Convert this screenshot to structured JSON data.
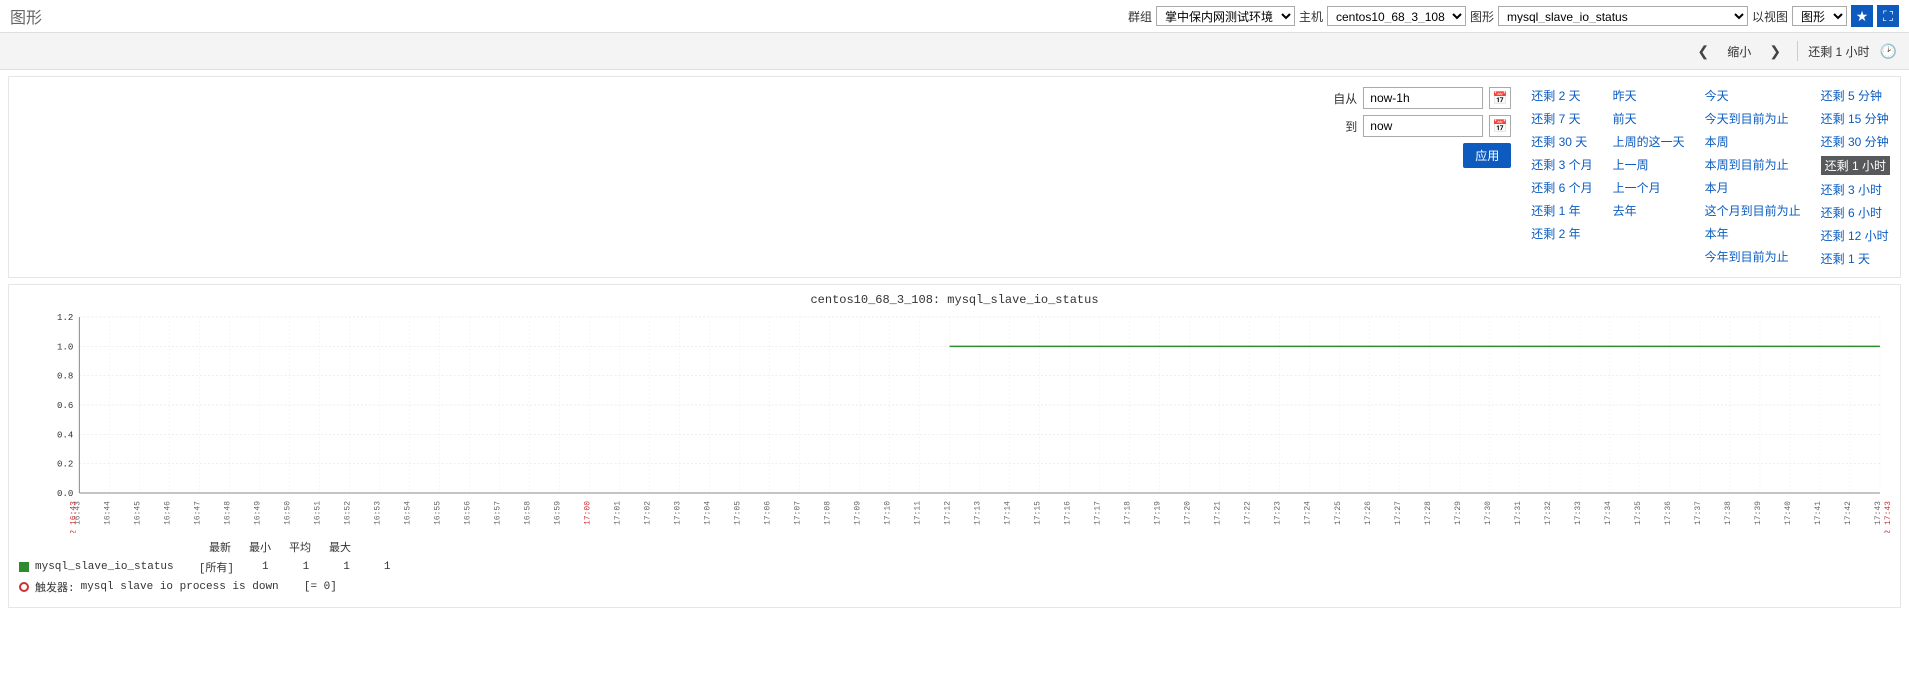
{
  "header": {
    "page_title": "图形",
    "group_label": "群组",
    "group_value": "掌中保内网测试环境",
    "host_label": "主机",
    "host_value": "centos10_68_3_108",
    "graph_label": "图形",
    "graph_value": "mysql_slave_io_status",
    "view_label": "以视图",
    "view_value": "图形"
  },
  "subbar": {
    "zoom_out": "缩小",
    "range_label": "还剩 1 小时"
  },
  "time": {
    "from_label": "自从",
    "from_value": "now-1h",
    "to_label": "到",
    "to_value": "now",
    "apply": "应用"
  },
  "presets": {
    "col1": [
      "还剩 2 天",
      "还剩 7 天",
      "还剩 30 天",
      "还剩 3 个月",
      "还剩 6 个月",
      "还剩 1 年",
      "还剩 2 年"
    ],
    "col2": [
      "昨天",
      "前天",
      "上周的这一天",
      "上一周",
      "上一个月",
      "去年"
    ],
    "col3": [
      "今天",
      "今天到目前为止",
      "本周",
      "本周到目前为止",
      "本月",
      "这个月到目前为止",
      "本年",
      "今年到目前为止"
    ],
    "col4": [
      "还剩 5 分钟",
      "还剩 15 分钟",
      "还剩 30 分钟",
      "还剩 1 小时",
      "还剩 3 小时",
      "还剩 6 小时",
      "还剩 12 小时",
      "还剩 1 天"
    ],
    "selected": "还剩 1 小时"
  },
  "chart_data": {
    "type": "line",
    "title": "centos10_68_3_108: mysql_slave_io_status",
    "ylabel": "",
    "ylim": [
      0,
      1.2
    ],
    "yticks": [
      0,
      0.2,
      0.4,
      0.6,
      0.8,
      1.0,
      1.2
    ],
    "x_start_label": "12-02 16:43",
    "x_end_label": "12-02 17:43",
    "x_ticks": [
      "16:43",
      "16:44",
      "16:45",
      "16:46",
      "16:47",
      "16:48",
      "16:49",
      "16:50",
      "16:51",
      "16:52",
      "16:53",
      "16:54",
      "16:55",
      "16:56",
      "16:57",
      "16:58",
      "16:59",
      "17:00",
      "17:01",
      "17:02",
      "17:03",
      "17:04",
      "17:05",
      "17:06",
      "17:07",
      "17:08",
      "17:09",
      "17:10",
      "17:11",
      "17:12",
      "17:13",
      "17:14",
      "17:15",
      "17:16",
      "17:17",
      "17:18",
      "17:19",
      "17:20",
      "17:21",
      "17:22",
      "17:23",
      "17:24",
      "17:25",
      "17:26",
      "17:27",
      "17:28",
      "17:29",
      "17:30",
      "17:31",
      "17:32",
      "17:33",
      "17:34",
      "17:35",
      "17:36",
      "17:37",
      "17:38",
      "17:39",
      "17:40",
      "17:41",
      "17:42",
      "17:43"
    ],
    "x_highlight": [
      "17:00"
    ],
    "series": [
      {
        "name": "mysql_slave_io_status",
        "color": "#2e8b2e",
        "data_start_tick": "17:12",
        "values_from_start": [
          1,
          1,
          1,
          1,
          1,
          1,
          1,
          1,
          1,
          1,
          1,
          1,
          1,
          1,
          1,
          1,
          1,
          1,
          1,
          1,
          1,
          1,
          1,
          1,
          1,
          1,
          1,
          1,
          1,
          1,
          1,
          1
        ]
      }
    ],
    "legend": {
      "series_name": "mysql_slave_io_status",
      "all_label": "[所有]",
      "stats_headers": [
        "最新",
        "最小",
        "平均",
        "最大"
      ],
      "stats_values": [
        "1",
        "1",
        "1",
        "1"
      ],
      "trigger_label": "触发器:",
      "trigger_text": "mysql slave io process is down",
      "trigger_expr": "[= 0]"
    }
  }
}
